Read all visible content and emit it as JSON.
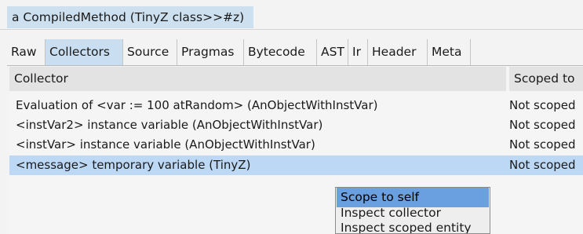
{
  "window": {
    "title": "a CompiledMethod (TinyZ class>>#z)"
  },
  "tabs": [
    {
      "label": "Raw",
      "selected": false
    },
    {
      "label": "Collectors",
      "selected": true
    },
    {
      "label": "Source",
      "selected": false
    },
    {
      "label": "Pragmas",
      "selected": false
    },
    {
      "label": "Bytecode",
      "selected": false
    },
    {
      "label": "AST",
      "selected": false
    },
    {
      "label": "Ir",
      "selected": false
    },
    {
      "label": "Header",
      "selected": false
    },
    {
      "label": "Meta",
      "selected": false
    }
  ],
  "table": {
    "columns": [
      "Collector",
      "Scoped to"
    ],
    "rows": [
      {
        "collector": "Evaluation of <var := 100 atRandom> (AnObjectWithInstVar)",
        "scoped_to": "Not scoped",
        "selected": false
      },
      {
        "collector": "<instVar2> instance variable (AnObjectWithInstVar)",
        "scoped_to": "Not scoped",
        "selected": false
      },
      {
        "collector": "<instVar> instance variable (AnObjectWithInstVar)",
        "scoped_to": "Not scoped",
        "selected": false
      },
      {
        "collector": "<message> temporary variable (TinyZ)",
        "scoped_to": "Not scoped",
        "selected": true
      }
    ]
  },
  "context_menu": {
    "items": [
      {
        "label": "Scope to self",
        "highlighted": true
      },
      {
        "label": "Inspect collector",
        "highlighted": false
      },
      {
        "label": "Inspect scoped entity",
        "highlighted": false
      }
    ]
  },
  "colors": {
    "title_chip": "#cde0ef",
    "selected_tab": "#c9def0",
    "selected_row": "#bcd8f4",
    "menu_highlight": "#6a9fe0",
    "header_bg": "#e3e3e3"
  }
}
